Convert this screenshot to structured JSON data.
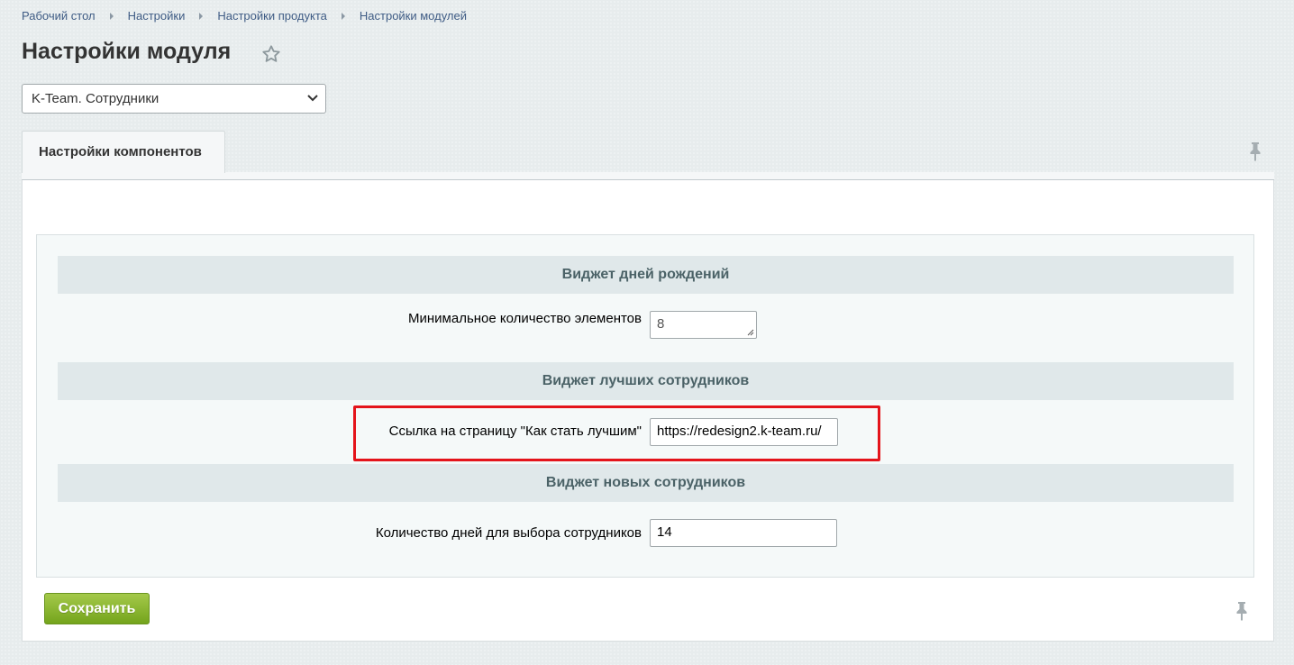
{
  "breadcrumb": {
    "items": [
      "Рабочий стол",
      "Настройки",
      "Настройки продукта",
      "Настройки модулей"
    ]
  },
  "page": {
    "title": "Настройки модуля"
  },
  "module_select": {
    "value": "K-Team. Сотрудники"
  },
  "tabs": [
    {
      "label": "Настройки компонентов"
    }
  ],
  "sections": [
    {
      "header": "Виджет дней рождений",
      "field": {
        "label": "Минимальное количество элементов",
        "value": "8"
      }
    },
    {
      "header": "Виджет лучших сотрудников",
      "field": {
        "label": "Ссылка на страницу \"Как стать лучшим\"",
        "value": "https://redesign2.k-team.ru/"
      }
    },
    {
      "header": "Виджет новых сотрудников",
      "field": {
        "label": "Количество дней для выбора сотрудников",
        "value": "14"
      }
    }
  ],
  "footer": {
    "save_label": "Сохранить"
  },
  "colors": {
    "accent_green": "#7bab24",
    "highlight_red": "#e4141b",
    "link_blue": "#3f5c85"
  }
}
